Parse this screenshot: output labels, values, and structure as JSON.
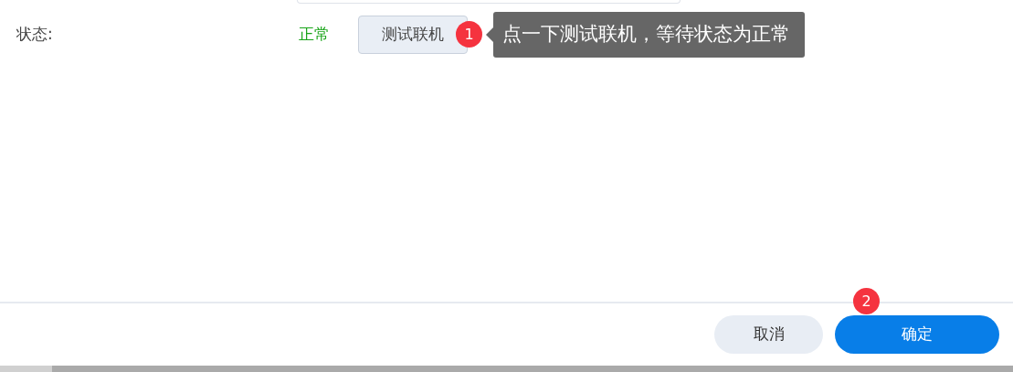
{
  "status_row": {
    "label": "状态:",
    "value": "正常",
    "ok": true,
    "test_button": "测试联机",
    "step_badge": "1",
    "tooltip": "点一下测试联机，等待状态为正常"
  },
  "footer": {
    "buttons": [
      {
        "label": "取消",
        "kind": "secondary"
      },
      {
        "label": "确定",
        "kind": "primary",
        "step_badge": "2"
      }
    ]
  }
}
